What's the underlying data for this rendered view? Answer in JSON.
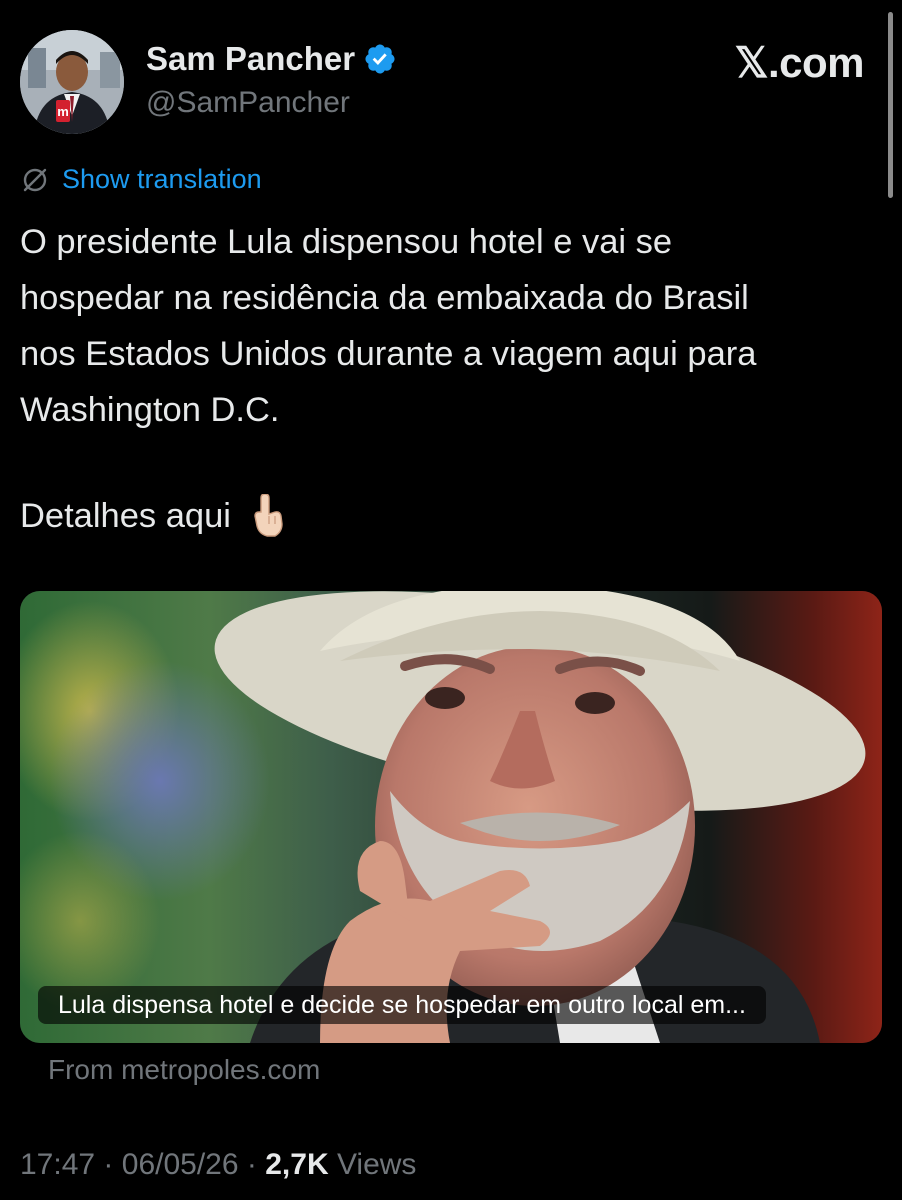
{
  "author": {
    "name": "Sam Pancher",
    "handle": "@SamPancher",
    "verified": true,
    "verified_color": "#1d9bf0"
  },
  "brand": "𝕏.com",
  "translation": {
    "label": "Show translation",
    "icon": "globe-slash-icon",
    "color": "#1d9bf0"
  },
  "tweet": {
    "text": "O presidente Lula dispensou hotel e vai se\nhospedar na residência da embaixada do Brasil\nnos Estados Unidos durante a viagem aqui para\nWashington D.C.",
    "detail": "Detalhes aqui",
    "detail_emoji": "pointing-down-hand-icon"
  },
  "card": {
    "title": "Lula dispensa hotel e decide se hospedar em outro local em...",
    "source": "From metropoles.com"
  },
  "meta": {
    "time": "17:47",
    "separator": "·",
    "date": "06/05/26",
    "views_count": "2,7K",
    "views_label": "Views"
  },
  "colors": {
    "background": "#000000",
    "text": "#e7e9ea",
    "secondary": "#71767b",
    "accent": "#1d9bf0"
  }
}
